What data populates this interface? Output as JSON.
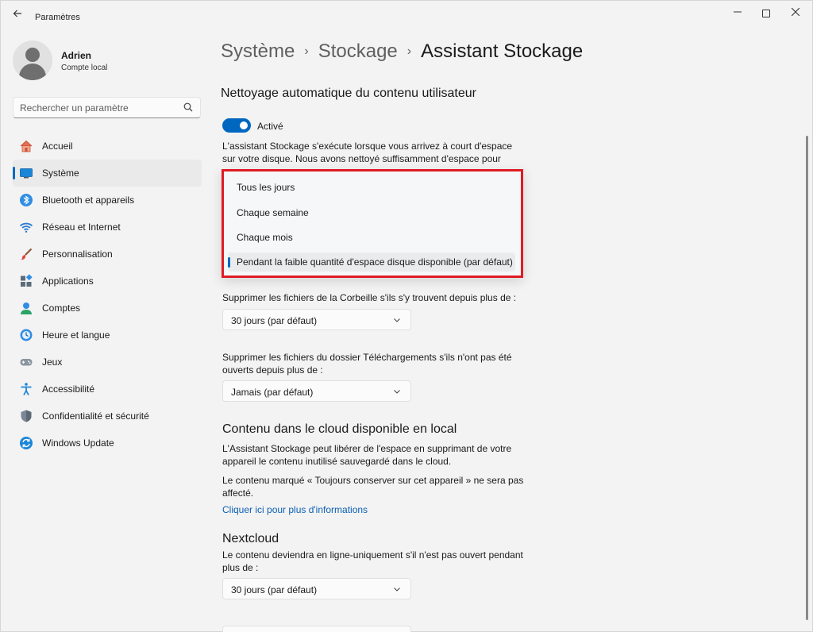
{
  "window": {
    "title": "Paramètres",
    "back_icon": "arrow-left-icon",
    "controls": {
      "minimize": "—",
      "close": "✕"
    }
  },
  "user": {
    "name": "Adrien",
    "account": "Compte local"
  },
  "search": {
    "placeholder": "Rechercher un paramètre"
  },
  "sidebar": {
    "items": [
      {
        "label": "Accueil",
        "icon": "home-icon",
        "active": false
      },
      {
        "label": "Système",
        "icon": "system-icon",
        "active": true
      },
      {
        "label": "Bluetooth et appareils",
        "icon": "bluetooth-icon",
        "active": false
      },
      {
        "label": "Réseau et Internet",
        "icon": "network-icon",
        "active": false
      },
      {
        "label": "Personnalisation",
        "icon": "brush-icon",
        "active": false
      },
      {
        "label": "Applications",
        "icon": "apps-icon",
        "active": false
      },
      {
        "label": "Comptes",
        "icon": "account-icon",
        "active": false
      },
      {
        "label": "Heure et langue",
        "icon": "time-language-icon",
        "active": false
      },
      {
        "label": "Jeux",
        "icon": "gamepad-icon",
        "active": false
      },
      {
        "label": "Accessibilité",
        "icon": "accessibility-icon",
        "active": false
      },
      {
        "label": "Confidentialité et sécurité",
        "icon": "shield-icon",
        "active": false
      },
      {
        "label": "Windows Update",
        "icon": "update-icon",
        "active": false
      }
    ]
  },
  "breadcrumb": {
    "part1": "Système",
    "part2": "Stockage",
    "current": "Assistant Stockage",
    "separator": "›"
  },
  "cleanup": {
    "title": "Nettoyage automatique du contenu utilisateur",
    "toggle_label": "Activé",
    "toggle_on": true,
    "description": "L'assistant Stockage s'exécute lorsque vous arrivez à court d'espace sur votre disque. Nous avons nettoyé suffisamment d'espace pour garantir"
  },
  "run_frequency": {
    "options": [
      "Tous les jours",
      "Chaque semaine",
      "Chaque mois",
      "Pendant la faible quantité d'espace disque disponible (par défaut)"
    ],
    "selected_index": 3
  },
  "recycle_bin": {
    "label": "Supprimer les fichiers de la Corbeille s'ils s'y trouvent depuis plus de :",
    "value": "30 jours (par défaut)"
  },
  "downloads": {
    "label_line1": "Supprimer les fichiers du dossier Téléchargements s'ils n'ont pas été",
    "label_line2": "ouverts depuis plus de :",
    "value": "Jamais (par défaut)"
  },
  "cloud": {
    "title": "Contenu dans le cloud disponible en local",
    "text1_line1": "L'Assistant Stockage peut libérer de l'espace en supprimant de votre",
    "text1_line2": "appareil le contenu inutilisé sauvegardé dans le cloud.",
    "text2_line1": "Le contenu marqué « Toujours conserver sur cet appareil » ne sera pas",
    "text2_line2": "affecté.",
    "link": "Cliquer ici pour plus d'informations"
  },
  "nextcloud": {
    "title": "Nextcloud",
    "label_line1": "Le contenu deviendra en ligne-uniquement s'il n'est pas ouvert pendant",
    "label_line2": "plus de :",
    "value": "30 jours (par défaut)"
  },
  "colors": {
    "accent": "#0067c0",
    "highlight_border": "#e01b24",
    "link": "#0a5fb4"
  }
}
